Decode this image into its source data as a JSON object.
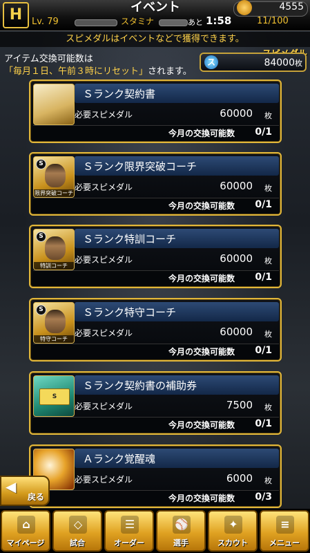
{
  "header": {
    "title": "イベント",
    "level": "Lv. 79",
    "stamina_label": "スタミナ",
    "ato": "あと",
    "timer": "1:58",
    "stamina_count": "11/100",
    "coins": "4555"
  },
  "notice": "スピメダルはイベントなどで獲得できます。",
  "info": {
    "line1": "アイテム交換可能数は",
    "line2_highlight": "「毎月１日、午前３時にリセット」",
    "line2_rest": "されます。"
  },
  "medal": {
    "label": "スピメダル",
    "value": "84000",
    "unit": "枚"
  },
  "common": {
    "required_label": "必要スピメダル",
    "unit": "枚",
    "exchange_label": "今月の交換可能数"
  },
  "items": [
    {
      "name": "Ｓランク契約書",
      "cost": "60000",
      "exchange": "0/1",
      "caption": ""
    },
    {
      "name": "Ｓランク限界突破コーチ",
      "cost": "60000",
      "exchange": "0/1",
      "caption": "限界突破コーチ"
    },
    {
      "name": "Ｓランク特訓コーチ",
      "cost": "60000",
      "exchange": "0/1",
      "caption": "特訓コーチ"
    },
    {
      "name": "Ｓランク特守コーチ",
      "cost": "60000",
      "exchange": "0/1",
      "caption": "特守コーチ"
    },
    {
      "name": "Ｓランク契約書の補助券",
      "cost": "7500",
      "exchange": "0/1",
      "caption": ""
    },
    {
      "name": "Ａランク覚醒魂",
      "cost": "6000",
      "exchange": "0/3",
      "caption": ""
    }
  ],
  "back_label": "戻る",
  "nav": [
    {
      "label": "マイページ",
      "icon": "home-icon"
    },
    {
      "label": "試合",
      "icon": "stadium-icon"
    },
    {
      "label": "オーダー",
      "icon": "order-icon"
    },
    {
      "label": "選手",
      "icon": "player-icon"
    },
    {
      "label": "スカウト",
      "icon": "scout-icon"
    },
    {
      "label": "メニュー",
      "icon": "menu-icon"
    }
  ]
}
